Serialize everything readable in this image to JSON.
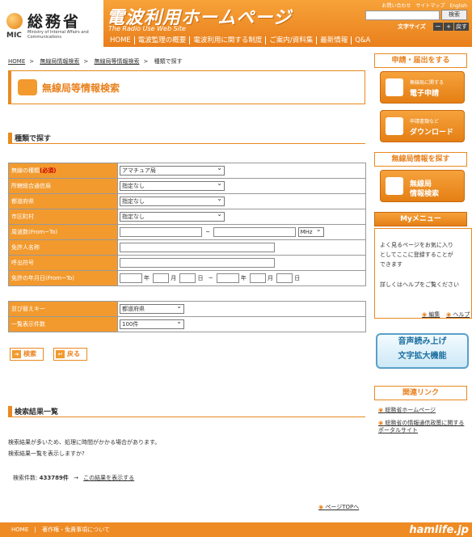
{
  "header": {
    "logo_mark_text": "MIC",
    "logo_jp": "総務省",
    "logo_en": "Ministry of Internal Affairs and Communications",
    "site_title": "電波利用ホームページ",
    "site_subtitle": "The Radio Use Web Site",
    "top_links": [
      "お問い合わせ",
      "サイトマップ",
      "English"
    ],
    "search_button": "検索",
    "fontsize_label": "文字サイズ",
    "fontsize_buttons": [
      "ー",
      "+",
      "戻す"
    ],
    "nav": [
      "HOME",
      "電波監理の概要",
      "電波利用に関する制度",
      "ご案内/資料集",
      "最新情報",
      "Q&A"
    ]
  },
  "breadcrumb": [
    "HOME",
    "無線局情報検索",
    "無線局等情報検索",
    "種類で探す"
  ],
  "page_title": "無線局等情報検索",
  "search_section": {
    "heading": "種類で探す",
    "required_mark": "(必須)",
    "rows": [
      {
        "label": "無線の種類",
        "value": "アマチュア局"
      },
      {
        "label": "所轄総合通信局",
        "value": "指定なし"
      },
      {
        "label": "都道府県",
        "value": "指定なし"
      },
      {
        "label": "市区町村",
        "value": "指定なし"
      },
      {
        "label": "周波数(From~To)",
        "tilde": "~",
        "unit": "MHz"
      },
      {
        "label": "免許人名称"
      },
      {
        "label": "呼出符号"
      },
      {
        "label": "免許の年月日(From~To)",
        "date_units": [
          "年",
          "月",
          "日"
        ],
        "tilde": "~"
      }
    ],
    "sort_rows": [
      {
        "label": "並び替えキー",
        "value": "都道府県"
      },
      {
        "label": "一覧表示件数",
        "value": "100件"
      }
    ],
    "search_button": "検索",
    "back_button": "戻る"
  },
  "results_section": {
    "heading": "検索結果一覧",
    "message_1": "検索結果が多いため、処理に時間がかかる場合があります。",
    "message_2": "検索結果一覧を表示しますか?",
    "count_label": "検索件数:",
    "count_value": "433789件",
    "arrow": "→",
    "show_link": "この結果を表示する"
  },
  "page_top": "ページTOPへ",
  "footer": {
    "links": [
      "HOME",
      "著作権・免責事項について"
    ],
    "watermark": "hamlife.jp"
  },
  "sidebar": {
    "apply_heading": "申請・届出をする",
    "e_application": {
      "small": "無線局に関する",
      "big": "電子申請"
    },
    "download": {
      "small": "申請書類など",
      "big": "ダウンロード"
    },
    "search_heading": "無線局情報を探す",
    "station_search": {
      "line1": "無線局",
      "line2": "情報検索"
    },
    "my_menu_heading": "Myメニュー",
    "my_menu_text": [
      "よく見るページをお気に入り",
      "としてここに登録することが",
      "できます",
      "詳しくはヘルプをご覧ください"
    ],
    "my_menu_links": [
      "編集",
      "ヘルプ"
    ],
    "speech": [
      "音声読み上げ",
      "文字拡大機能"
    ],
    "related_heading": "関連リンク",
    "related_links": [
      "総務省ホームページ",
      "総務省の情報通信政策に関するポータルサイト"
    ]
  }
}
